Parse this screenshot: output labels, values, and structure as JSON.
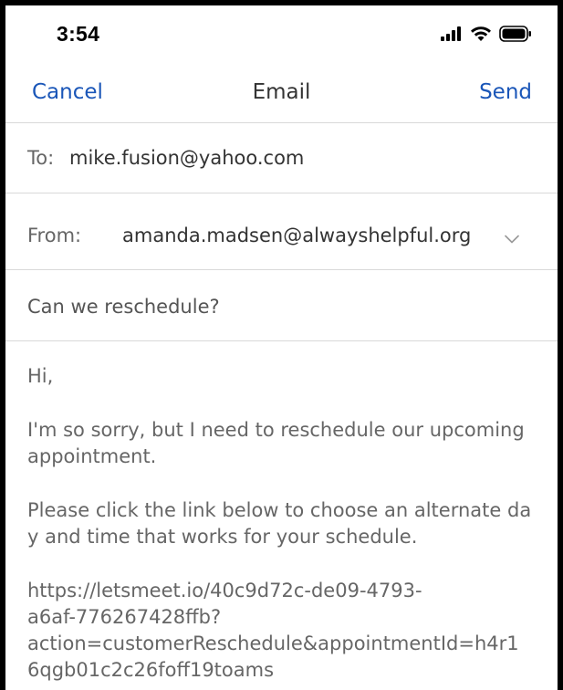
{
  "status_bar": {
    "time": "3:54",
    "icons": [
      "cellular-signal-icon",
      "wifi-icon",
      "battery-icon"
    ]
  },
  "nav": {
    "cancel_label": "Cancel",
    "title": "Email",
    "send_label": "Send",
    "accent_color": "#1a56b8"
  },
  "to": {
    "label": "To:",
    "value": "mike.fusion@yahoo.com"
  },
  "from": {
    "label": "From:",
    "value": "amanda.madsen@alwayshelpful.org",
    "dropdown_icon": "chevron-down-icon"
  },
  "subject": {
    "value": "Can we reschedule?"
  },
  "body": {
    "greeting": "Hi,",
    "paragraph1": "I'm so sorry, but I need to reschedule our upcoming appointment.",
    "paragraph2": "Please click the link below to choose an alternate day and time that works for your schedule.",
    "link_lines": [
      "https://letsmeet.io/40c9d72c-de09-4793-",
      "a6af-776267428ffb?",
      "action=customerReschedule&appointmentId=h4r1",
      "6qgb01c2c26foff19toams"
    ]
  }
}
